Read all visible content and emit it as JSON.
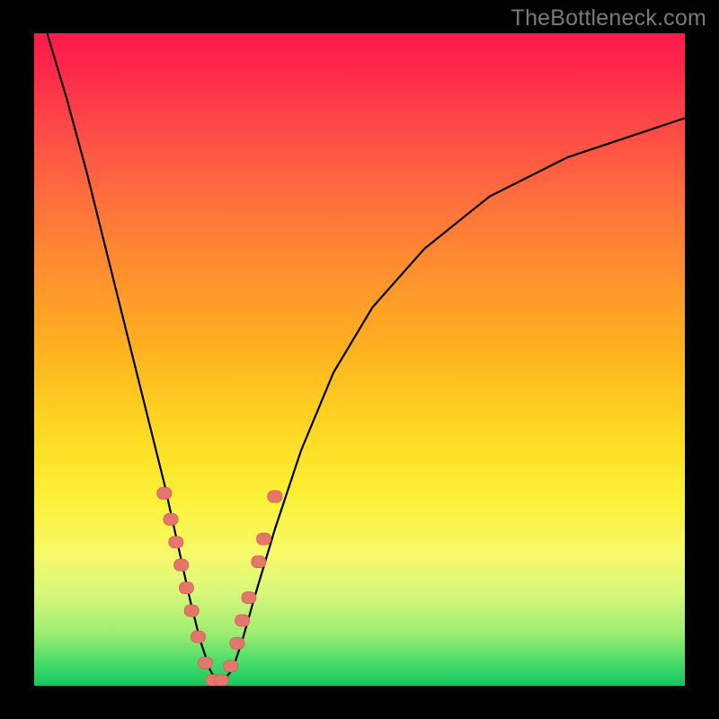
{
  "watermark": "TheBottleneck.com",
  "colors": {
    "frame": "#000000",
    "gradient_top": "#ff1a4a",
    "gradient_bottom": "#16c65c",
    "curve": "#000000",
    "marker_fill": "#e5766b"
  },
  "chart_data": {
    "type": "line",
    "title": "",
    "xlabel": "",
    "ylabel": "",
    "xlim": [
      0,
      100
    ],
    "ylim": [
      0,
      100
    ],
    "notes": "No axis ticks or labels are rendered; values are estimated in percent of plot area. Lower y = 0 (bottom), higher y = 100 (top). Single V-shaped curve with minimum near x≈28.",
    "series": [
      {
        "name": "bottleneck-curve",
        "x": [
          2,
          5,
          8,
          11,
          14,
          17,
          20,
          22,
          24,
          25.5,
          27,
          28,
          29,
          30.5,
          32,
          34,
          37,
          41,
          46,
          52,
          60,
          70,
          82,
          94,
          100
        ],
        "y": [
          100,
          90,
          79,
          67,
          55,
          43,
          31,
          22,
          13,
          7,
          2.5,
          0.7,
          0.7,
          2.5,
          7,
          14,
          24,
          36,
          48,
          58,
          67,
          75,
          81,
          85,
          87
        ]
      }
    ],
    "markers": {
      "name": "salmon-dots",
      "shape": "rounded-rect",
      "points": [
        {
          "x": 20.0,
          "y": 29.5
        },
        {
          "x": 21.0,
          "y": 25.5
        },
        {
          "x": 21.8,
          "y": 22.0
        },
        {
          "x": 22.6,
          "y": 18.5
        },
        {
          "x": 23.4,
          "y": 15.0
        },
        {
          "x": 24.2,
          "y": 11.5
        },
        {
          "x": 25.2,
          "y": 7.5
        },
        {
          "x": 26.3,
          "y": 3.5
        },
        {
          "x": 27.5,
          "y": 0.8
        },
        {
          "x": 28.8,
          "y": 0.8
        },
        {
          "x": 30.2,
          "y": 3.0
        },
        {
          "x": 31.2,
          "y": 6.5
        },
        {
          "x": 32.0,
          "y": 10.0
        },
        {
          "x": 33.0,
          "y": 13.5
        },
        {
          "x": 34.5,
          "y": 19.0
        },
        {
          "x": 35.3,
          "y": 22.5
        },
        {
          "x": 37.0,
          "y": 29.0
        }
      ]
    }
  }
}
